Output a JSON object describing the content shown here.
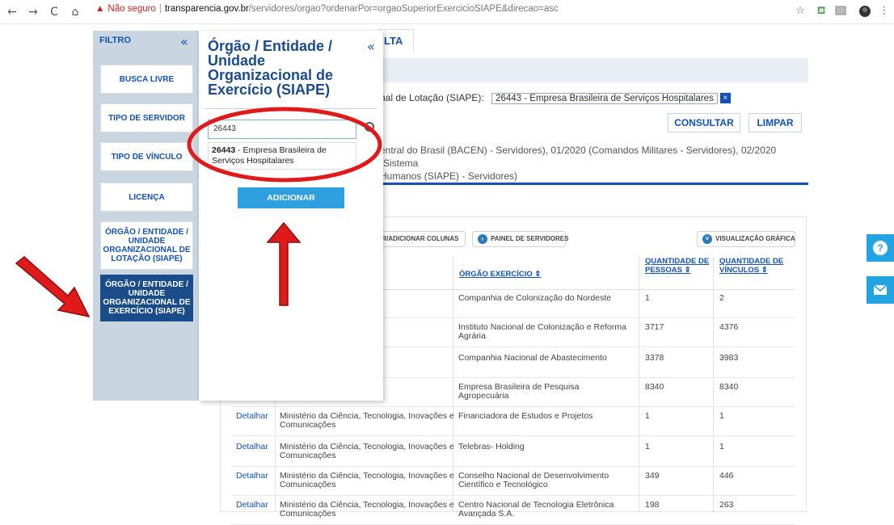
{
  "browser": {
    "back_icon": "←",
    "forward_icon": "→",
    "reload_icon": "C",
    "home_icon": "⌂",
    "warning": "▲",
    "not_secure": "Não seguro",
    "host": "transparencia.gov.br",
    "path": "/servidores/orgao?ordenarPor=orgaoSuperiorExercicioSIAPE&direcao=asc"
  },
  "background": {
    "tab_fragment": "LTA",
    "filter_label": "nal de Lotação (SIAPE):",
    "chip_text": "26443 - Empresa Brasileira de Serviços Hospitalares",
    "chip_x": "×",
    "consultar": "CONSULTAR",
    "limpar": "LIMPAR",
    "info_line1": "entral do Brasil (BACEN) - Servidores), 01/2020 (Comandos Militares - Servidores), 02/2020 (Sistema",
    "info_line2": "Humanos (SIAPE) - Servidores)",
    "pill_columns": "ER/ADICIONAR COLUNAS",
    "pill_painel": "PAINEL DE SERVIDORES",
    "pill_visual": "VISUALIZAÇÃO GRÁFICA"
  },
  "table": {
    "headers": {
      "orgao_exercicio": "ÓRGÃO EXERCÍCIO ⇕",
      "qtd_pessoas_1": "QUANTIDADE DE",
      "qtd_pessoas_2": "PESSOAS ⇕",
      "qtd_vinculos_1": "QUANTIDADE DE",
      "qtd_vinculos_2": "VÍNCULOS ⇕"
    },
    "rows": [
      {
        "detalhar": "",
        "superior": "cuária e",
        "exercicio": "Companhia de Colonização do Nordeste",
        "pessoas": "1",
        "vinculos": "2"
      },
      {
        "detalhar": "",
        "superior": "cuária e",
        "exercicio": "Instituto Nacional de Colonização e Reforma Agrária",
        "pessoas": "3717",
        "vinculos": "4376"
      },
      {
        "detalhar": "",
        "superior": "cuária e",
        "exercicio": "Companhia Nacional de Abastecimento",
        "pessoas": "3378",
        "vinculos": "3983"
      },
      {
        "detalhar": "",
        "superior": "cuária e",
        "exercicio": "Empresa Brasileira de Pesquisa Agropecuária",
        "pessoas": "8340",
        "vinculos": "8340"
      },
      {
        "detalhar": "Detalhar",
        "superior": "Ministério da Ciência, Tecnologia, Inovações e Comunicações",
        "exercicio": "Financiadora de Estudos e Projetos",
        "pessoas": "1",
        "vinculos": "1"
      },
      {
        "detalhar": "Detalhar",
        "superior": "Ministério da Ciência, Tecnologia, Inovações e Comunicações",
        "exercicio": "Telebras- Holding",
        "pessoas": "1",
        "vinculos": "1"
      },
      {
        "detalhar": "Detalhar",
        "superior": "Ministério da Ciência, Tecnologia, Inovações e Comunicações",
        "exercicio": "Conselho Nacional de Desenvolvimento Científico e Tecnológico",
        "pessoas": "349",
        "vinculos": "446"
      },
      {
        "detalhar": "Detalhar",
        "superior": "Ministério da Ciência, Tecnologia, Inovações e Comunicações",
        "exercicio": "Centro Nacional de Tecnologia Eletrônica Avançada S.A.",
        "pessoas": "198",
        "vinculos": "263"
      }
    ]
  },
  "sidebar": {
    "title": "FILTRO",
    "collapse": "«",
    "items": [
      {
        "label": "BUSCA LIVRE"
      },
      {
        "label": "TIPO DE SERVIDOR"
      },
      {
        "label": "TIPO DE VÍNCULO"
      },
      {
        "label": "LICENÇA"
      },
      {
        "label": "ÓRGÃO / ENTIDADE / UNIDADE ORGANIZACIONAL DE LOTAÇÃO (SIAPE)"
      },
      {
        "label": "ÓRGÃO / ENTIDADE / UNIDADE ORGANIZACIONAL DE EXERCÍCIO (SIAPE)"
      }
    ]
  },
  "popup": {
    "title": "Órgão / Entidade / Unidade Organizacional de Exercício (SIAPE)",
    "collapse": "«",
    "search_value": "26443",
    "suggestion_code": "26443",
    "suggestion_text": " - Empresa Brasileira de Serviços Hospitalares",
    "add_button": "ADICIONAR"
  },
  "floating": {
    "help": "?",
    "icons": [
      "help-icon",
      "mail-icon"
    ]
  },
  "colors": {
    "primary": "#1351b4",
    "sidebar_bg": "#c9d6e1",
    "selected": "#1b4c8a",
    "add_button": "#2e9fdf",
    "fab": "#22a4e3",
    "annotation_red": "#e0191b"
  }
}
